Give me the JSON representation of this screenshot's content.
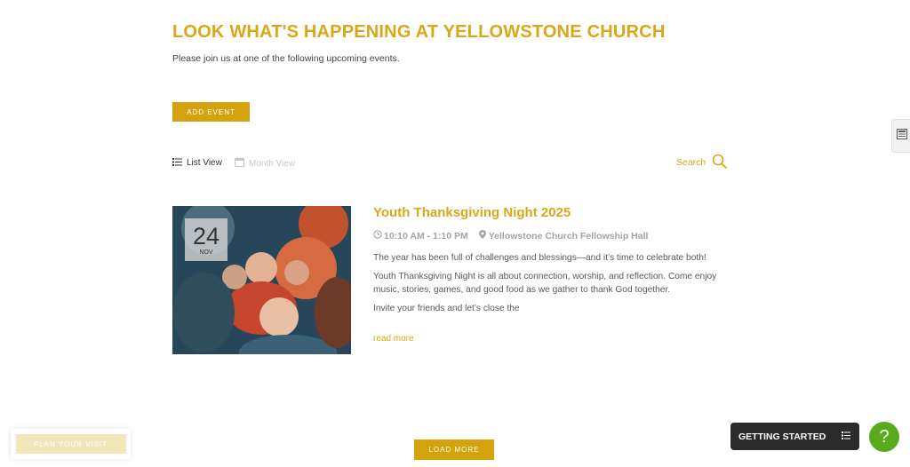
{
  "header": {
    "title": "LOOK WHAT'S HAPPENING AT YELLOWSTONE CHURCH",
    "intro": "Please join us at one of the following upcoming events."
  },
  "toolbar": {
    "add_event_label": "ADD EVENT",
    "list_view_label": "List View",
    "month_view_label": "Month View",
    "search_label": "Search"
  },
  "event": {
    "title": "Youth Thanksgiving Night 2025",
    "time": "10:10 AM - 1:10 PM",
    "location": "Yellowstone Church Fellowship Hall",
    "date_day": "24",
    "date_month": "NOV",
    "description": [
      "The year has been full of challenges and blessings—and it’s time to celebrate both!",
      "Youth Thanksgiving Night is all about connection, worship, and reflection. Come enjoy music, stories, games, and good food as we gather to thank God together.",
      "Invite your friends and let’s close the"
    ],
    "read_more_label": "read more"
  },
  "footer": {
    "load_more_label": "LOAD MORE",
    "plan_visit_label": "PLAN YOUR VISIT",
    "getting_started_label": "GETTING STARTED",
    "help_label": "?"
  },
  "colors": {
    "accent": "#d4a20d",
    "title": "#d8a71a",
    "help": "#5aaa1d",
    "dark_panel": "#2b2b2b"
  }
}
